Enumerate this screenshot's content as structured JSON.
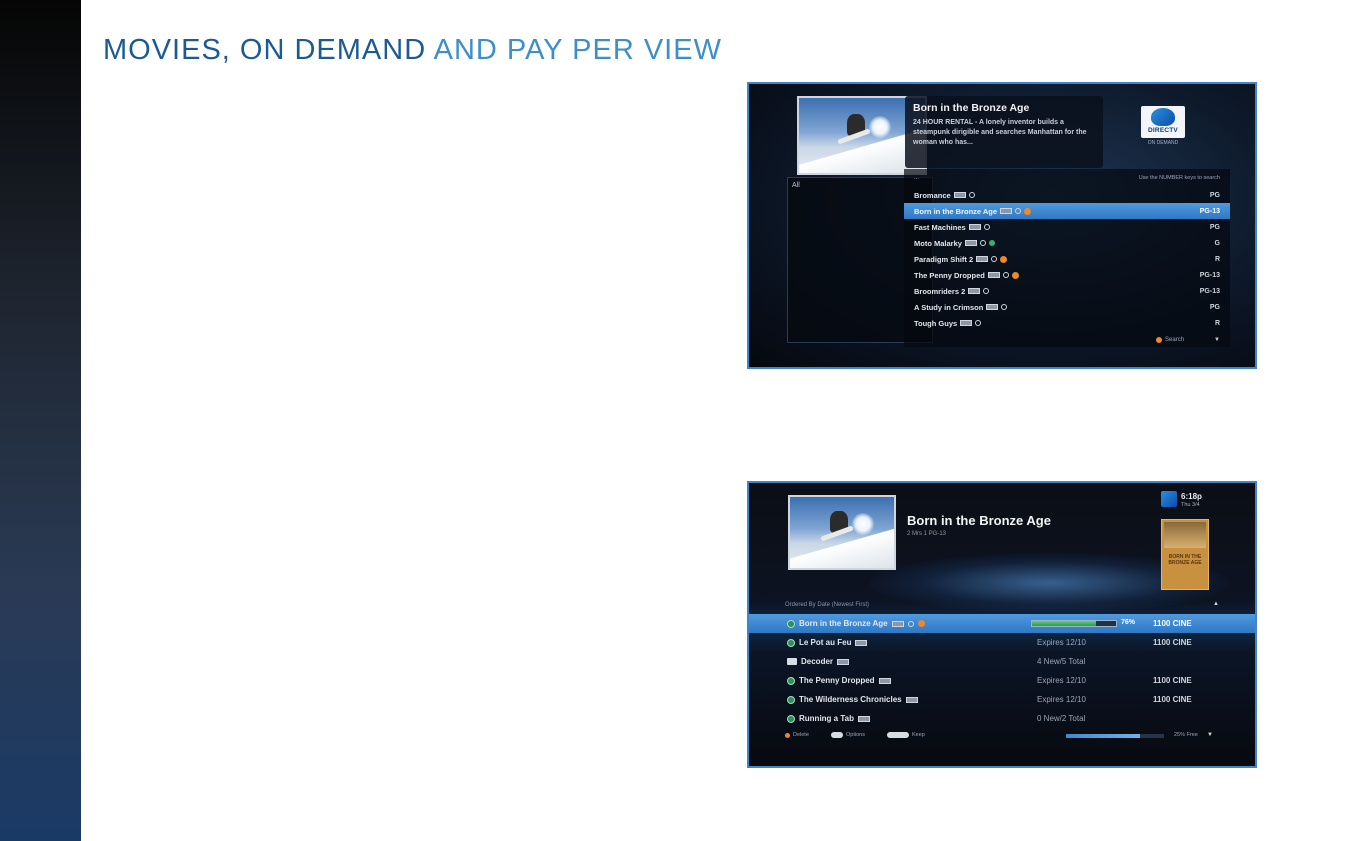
{
  "page": {
    "title_part1": "MOVIES, ON DEMAND ",
    "title_part2": "AND PAY PER VIEW"
  },
  "colors": {
    "title_dark": "#1c5a95",
    "title_light": "#3d8fcc",
    "screen_border": "#3f86c8",
    "highlight": "#3f88d2",
    "progress_green": "#37b06a",
    "record_orange": "#e98a2c"
  },
  "on_demand_screen": {
    "info": {
      "title": "Born in the Bronze Age",
      "description": "24 HOUR RENTAL - A lonely inventor builds a steampunk dirigible and searches Manhattan for the woman who has..."
    },
    "brand": {
      "logo_text": "DIRECTV",
      "sub_text": "ON DEMAND"
    },
    "left_panel_label": "All",
    "list_header": {
      "dots": "...",
      "hint": "Use the NUMBER keys to search"
    },
    "movies": [
      {
        "name": "Bromance",
        "rating": "PG",
        "selected": false,
        "icons": [
          "hd-icon",
          "circle-icon"
        ]
      },
      {
        "name": "Born in the Bronze Age",
        "rating": "PG-13",
        "selected": true,
        "icons": [
          "hd-icon",
          "circle-icon",
          "record-icon"
        ]
      },
      {
        "name": "Fast Machines",
        "rating": "PG",
        "selected": false,
        "icons": [
          "hd-icon",
          "circle-icon"
        ]
      },
      {
        "name": "Moto Malarky",
        "rating": "G",
        "selected": false,
        "icons": [
          "hd-icon",
          "circle-icon",
          "green-icon"
        ]
      },
      {
        "name": "Paradigm Shift 2",
        "rating": "R",
        "selected": false,
        "icons": [
          "hd-icon",
          "circle-icon",
          "record-icon"
        ]
      },
      {
        "name": "The Penny Dropped",
        "rating": "PG-13",
        "selected": false,
        "icons": [
          "hd-icon",
          "circle-icon",
          "record-icon"
        ]
      },
      {
        "name": "Broomriders 2",
        "rating": "PG-13",
        "selected": false,
        "icons": [
          "hd-icon",
          "circle-icon"
        ]
      },
      {
        "name": "A Study in Crimson",
        "rating": "PG",
        "selected": false,
        "icons": [
          "hd-icon",
          "circle-icon"
        ]
      },
      {
        "name": "Tough Guys",
        "rating": "R",
        "selected": false,
        "icons": [
          "hd-icon",
          "circle-icon"
        ]
      }
    ],
    "footer": {
      "search_label": "Search",
      "scroll_arrow": "▼"
    }
  },
  "playlist_screen": {
    "title": "Born in the Bronze Age",
    "subtitle": "2 Mrs 1 PG-13",
    "time": "6:18p",
    "date": "Thu 3/4",
    "poster_text": "BORN IN THE BRONZE AGE",
    "ordered_label": "Ordered By Date (Newest First)",
    "up_arrow": "▲",
    "items": [
      {
        "name": "Born in the Bronze Age",
        "type": "disc",
        "status": "",
        "progress": 0.76,
        "progress_label": "76%",
        "channel": "1100 CINE",
        "selected": true
      },
      {
        "name": "Le Pot au Feu",
        "type": "disc",
        "status": "Expires 12/10",
        "channel": "1100 CINE",
        "selected": false
      },
      {
        "name": "Decoder",
        "type": "folder",
        "status": "4 New/5 Total",
        "channel": "",
        "selected": false
      },
      {
        "name": "The Penny Dropped",
        "type": "disc",
        "status": "Expires 12/10",
        "channel": "1100 CINE",
        "selected": false
      },
      {
        "name": "The Wilderness Chronicles",
        "type": "disc",
        "status": "Expires 12/10",
        "channel": "1100 CINE",
        "selected": false
      },
      {
        "name": "Running a Tab",
        "type": "disc",
        "status": "0 New/2 Total",
        "channel": "",
        "selected": false
      }
    ],
    "footer": {
      "delete_label": "Delete",
      "options_label": "Options",
      "keep_label": "Keep",
      "disk_fraction": 0.75,
      "disk_label": "25% Free",
      "down_arrow": "▼"
    }
  }
}
